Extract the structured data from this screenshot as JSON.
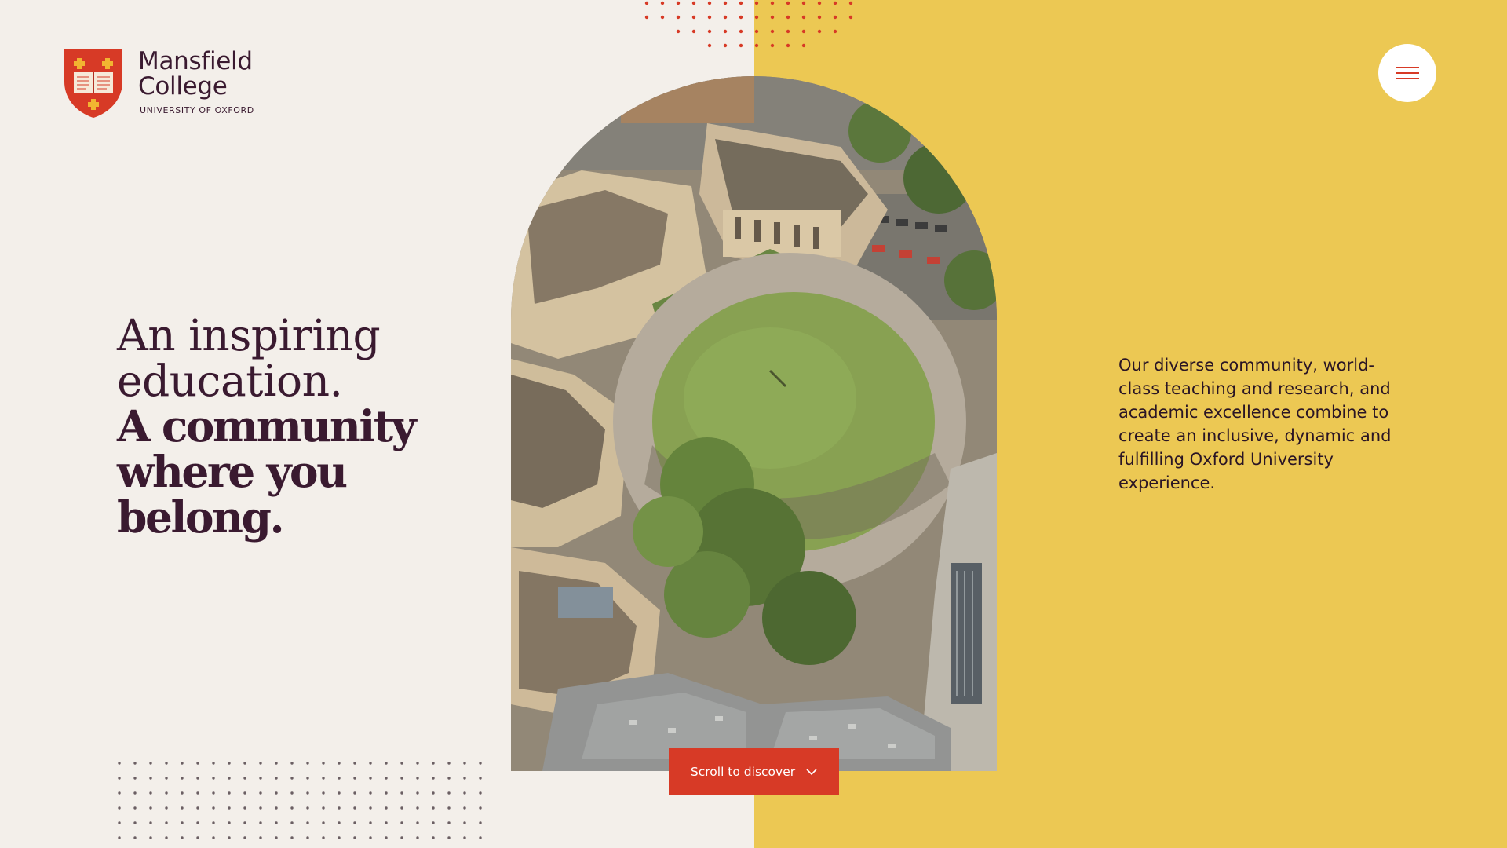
{
  "brand": {
    "name_line1": "Mansfield",
    "name_line2": "College",
    "subtitle": "UNIVERSITY OF OXFORD",
    "crest_colors": {
      "shield": "#d73a26",
      "cross": "#f2b431",
      "book": "#f6e9d8"
    }
  },
  "menu": {
    "icon": "hamburger-icon",
    "label": "Menu"
  },
  "hero": {
    "headline_light_line1": "An inspiring",
    "headline_light_line2": "education.",
    "headline_bold_line1": "A community",
    "headline_bold_line2": "where you",
    "headline_bold_line3": "belong.",
    "intro": "Our diverse community, world-class teaching and research, and academic excellence combine to create an inclusive, dynamic and fulfilling Oxford University experience."
  },
  "cta": {
    "scroll_label": "Scroll to discover",
    "icon": "chevron-down-icon"
  },
  "colors": {
    "background_left": "#f3efea",
    "background_right": "#ecc853",
    "accent": "#d73a26",
    "text": "#3a1a30"
  }
}
